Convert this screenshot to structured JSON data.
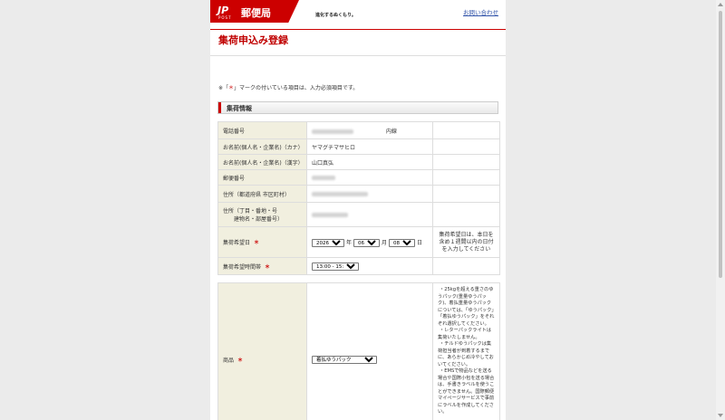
{
  "header": {
    "logo_mark": "JP",
    "logo_post": "POST",
    "logo_name": "郵便局",
    "tagline": "進化するぬくもり。",
    "contact_link": "お問い合わせ"
  },
  "page_title": "集荷申込み登録",
  "required_note": {
    "prefix": "※「",
    "mark": "＊",
    "suffix": "」マークの付いている項目は、入力必須項目です。"
  },
  "section_title": "集荷情報",
  "fields": {
    "phone": {
      "label": "電話番号",
      "suffix": "内線"
    },
    "name_kana": {
      "label": "お名前(個人名・企業名)（カナ）",
      "value": "ヤマグチマサヒロ"
    },
    "name_kanji": {
      "label": "お名前(個人名・企業名)（漢字）",
      "value": "山口真弘"
    },
    "postal": {
      "label": "郵便番号"
    },
    "address1": {
      "label": "住所（都道府県 市区町村）"
    },
    "address2": {
      "label_line1": "住所（丁目・番地・号",
      "label_line2": "建物名・部屋番号）"
    },
    "pickup_date": {
      "label": "集荷希望日",
      "year": "2026",
      "year_unit": "年",
      "month": "06",
      "month_unit": "月",
      "day": "08",
      "day_unit": "日",
      "note": "集荷希望日は、本日を含め１週間以内の日付を入力してください"
    },
    "pickup_time": {
      "label": "集荷希望時間帯",
      "value": "13:00 - 15:00"
    },
    "product": {
      "label": "商品",
      "value": "着払ゆうパック",
      "notes": [
        "・25kgを超える重さのゆうパック(重量ゆうパック)、着払重量ゆうパックについては、「ゆうパック」「着払ゆうパック」をそれぞれ選択してください。",
        "・レターパックライトは集荷いたしません。",
        "・チルドゆうパックは集荷担当者が到着するまでに、あらかじめ冷やしておいてください。",
        "・EMSで物品などを送る場合や国際小包を送る場合は、手書きラベルを使うことができません。国際郵便マイページサービスで事前にラベルを作成してください。"
      ]
    }
  },
  "colors": {
    "brand_red": "#cc0000",
    "label_bg": "#f1efdf",
    "required": "#cc0000"
  }
}
